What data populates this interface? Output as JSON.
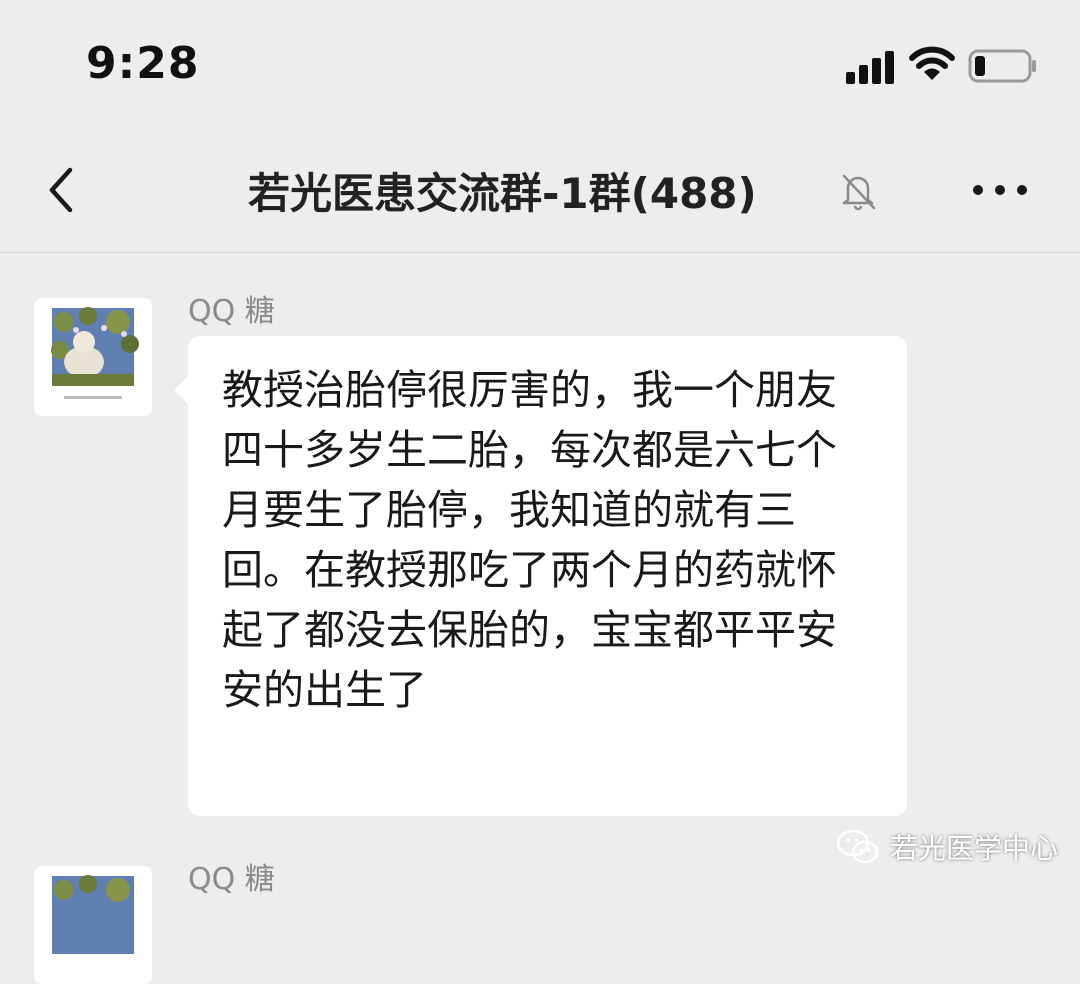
{
  "status_bar": {
    "time": "9:28",
    "signal_icon": "cellular-signal-icon",
    "wifi_icon": "wifi-icon",
    "battery_icon": "battery-icon",
    "battery_level": 0.2
  },
  "nav": {
    "back_icon": "chevron-left-icon",
    "title": "若光医患交流群-1群(488)",
    "mute_icon": "bell-muted-icon",
    "more_icon": "more-dots-icon"
  },
  "messages": [
    {
      "sender": "QQ 糖",
      "text": "教授治胎停很厉害的，我一个朋友四十多岁生二胎，每次都是六七个月要生了胎停，我知道的就有三回。在教授那吃了两个月的药就怀起了都没去保胎的，宝宝都平平安安的出生了"
    },
    {
      "sender": "QQ 糖"
    }
  ],
  "watermark": {
    "icon": "wechat-icon",
    "text": "若光医学中心"
  },
  "colors": {
    "background": "#ededed",
    "bubble": "#ffffff",
    "sender_name": "#8a8a8a"
  }
}
